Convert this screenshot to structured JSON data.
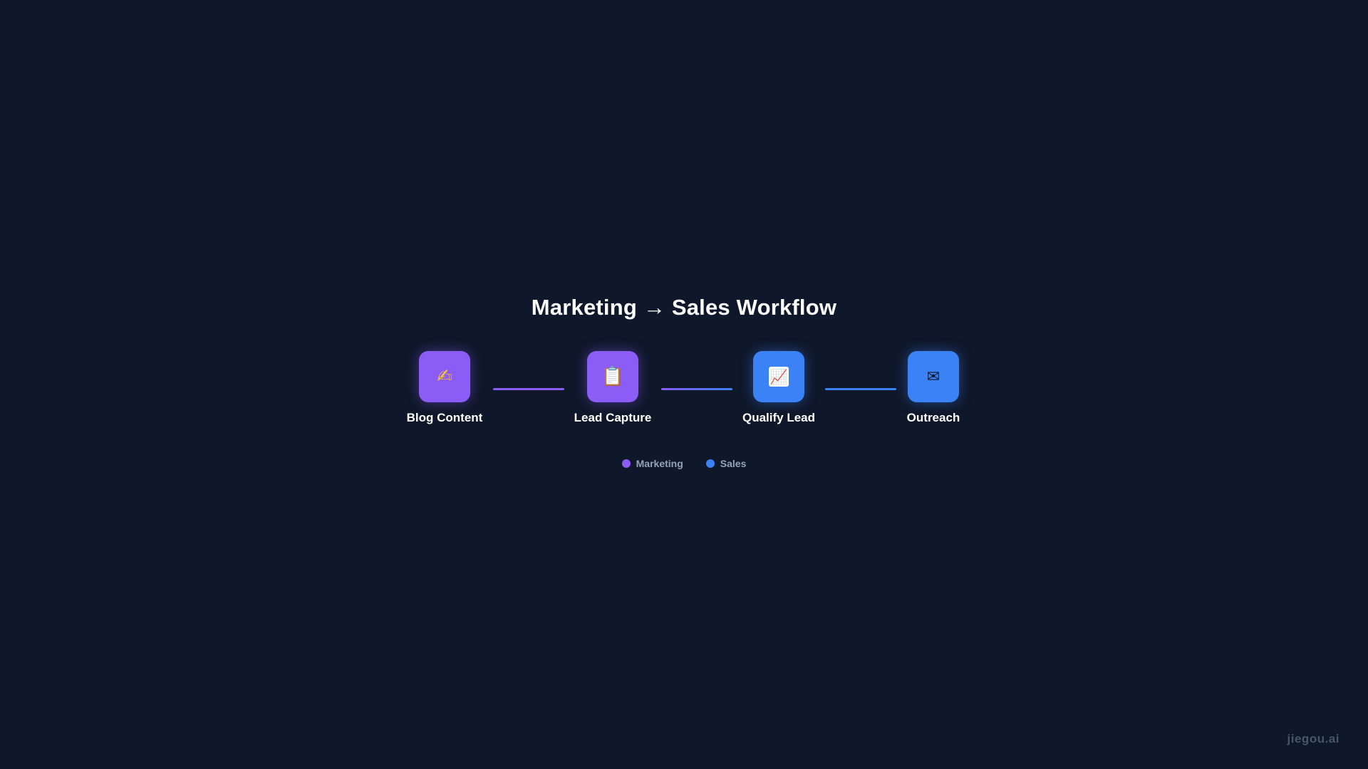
{
  "title": "Marketing → Sales Workflow",
  "colors": {
    "background": "#0f172a",
    "marketing": "#8b5cf6",
    "sales": "#3b82f6"
  },
  "nodes": [
    {
      "label": "Blog Content",
      "icon": "writing-hand-icon",
      "glyph": "✍",
      "group": "marketing"
    },
    {
      "label": "Lead Capture",
      "icon": "clipboard-icon",
      "glyph": "📋",
      "group": "marketing"
    },
    {
      "label": "Qualify Lead",
      "icon": "chart-increasing-icon",
      "glyph": "📈",
      "group": "sales"
    },
    {
      "label": "Outreach",
      "icon": "envelope-icon",
      "glyph": "✉",
      "group": "sales"
    }
  ],
  "connectors": [
    {
      "from": "Blog Content",
      "to": "Lead Capture"
    },
    {
      "from": "Lead Capture",
      "to": "Qualify Lead"
    },
    {
      "from": "Qualify Lead",
      "to": "Outreach"
    }
  ],
  "legend": [
    {
      "label": "Marketing",
      "group": "marketing"
    },
    {
      "label": "Sales",
      "group": "sales"
    }
  ],
  "watermark": "jiegou.ai"
}
